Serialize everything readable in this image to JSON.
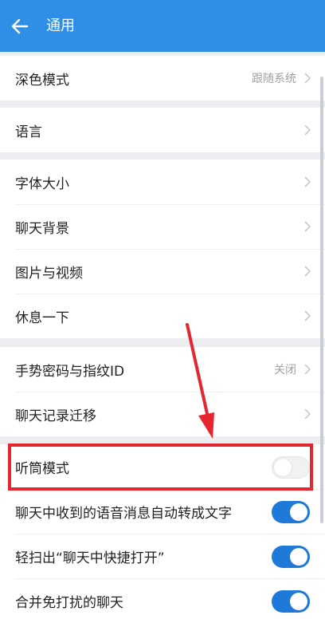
{
  "header": {
    "title": "通用",
    "back_icon": "arrow-left-icon",
    "bg_color": "#2f8ee6"
  },
  "groups": [
    {
      "items": [
        {
          "label": "深色模式",
          "value": "跟随系统"
        }
      ]
    },
    {
      "items": [
        {
          "label": "语言"
        }
      ]
    },
    {
      "items": [
        {
          "label": "字体大小"
        },
        {
          "label": "聊天背景"
        },
        {
          "label": "图片与视频"
        },
        {
          "label": "休息一下"
        }
      ]
    },
    {
      "items": [
        {
          "label": "手势密码与指纹ID",
          "value": "关闭"
        },
        {
          "label": "聊天记录迁移"
        }
      ]
    },
    {
      "items": [
        {
          "label": "听筒模式",
          "toggle": false
        },
        {
          "label": "聊天中收到的语音消息自动转成文字",
          "toggle": true
        },
        {
          "label": "轻扫出“聊天中快捷打开”",
          "toggle": true
        },
        {
          "label": "合并免打扰的聊天",
          "toggle": true
        }
      ]
    }
  ],
  "annotation": {
    "highlight_color": "#e5262f",
    "arrow_color": "#e5262f"
  },
  "toggle_on_color": "#1f79d8"
}
